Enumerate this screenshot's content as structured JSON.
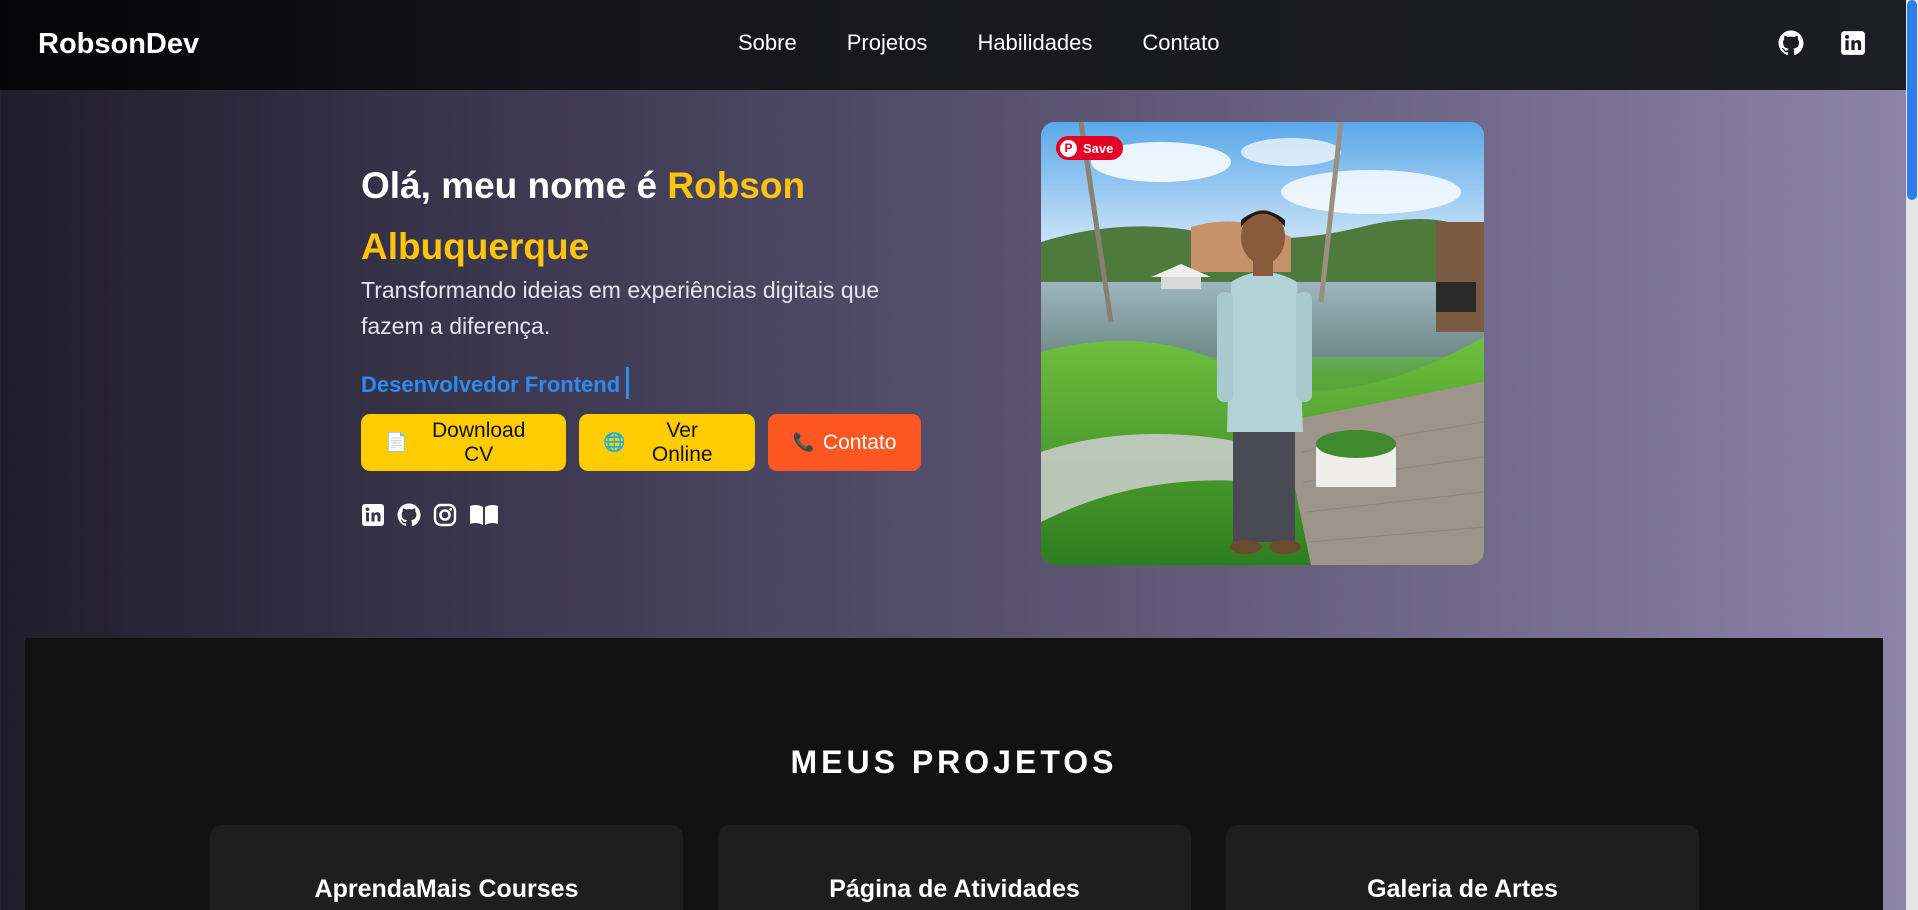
{
  "nav": {
    "brand": "RobsonDev",
    "links": [
      "Sobre",
      "Projetos",
      "Habilidades",
      "Contato"
    ],
    "icons": [
      "github-icon",
      "linkedin-icon"
    ]
  },
  "hero": {
    "title_prefix": "Olá, meu nome é ",
    "title_name": "Robson Albuquerque",
    "subtitle": "Transformando ideias em experiências digitais que fazem a diferença.",
    "role": "Desenvolvedor Frontend",
    "buttons": [
      {
        "label": "Download CV",
        "icon": "📄"
      },
      {
        "label": "Ver Online",
        "icon": "🌐"
      },
      {
        "label": "Contato",
        "icon": "📞"
      }
    ],
    "social_icons": [
      "linkedin-icon",
      "github-icon",
      "instagram-icon",
      "book-icon"
    ]
  },
  "photo": {
    "save_label": "Save",
    "pin_letter": "P"
  },
  "projects": {
    "heading": "MEUS PROJETOS",
    "cards": [
      "AprendaMais Courses",
      "Página de Atividades",
      "Galeria de Artes"
    ]
  },
  "colors": {
    "accent_yellow": "#ffc410",
    "role_blue": "#2d8bf0",
    "button_yellow": "#ffcc00",
    "button_orange": "#ff5722",
    "pinterest_red": "#e60023"
  }
}
